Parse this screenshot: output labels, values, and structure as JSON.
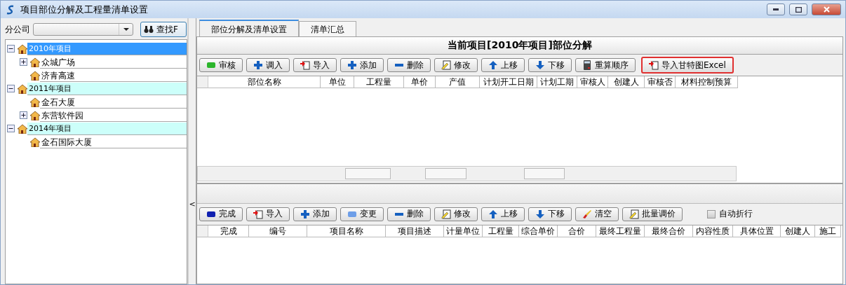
{
  "window": {
    "title": "项目部位分解及工程量清单设置"
  },
  "left_panel": {
    "branch_label": "分公司",
    "find_button": "查找F",
    "tree": [
      {
        "label": "2010年项目",
        "selected": true,
        "expanded": true,
        "children": [
          {
            "label": "众城广场",
            "selected": false,
            "expanded": false
          },
          {
            "label": "济青高速",
            "selected": false
          }
        ]
      },
      {
        "label": "2011年项目",
        "selected": false,
        "expanded": true,
        "children": [
          {
            "label": "金石大厦",
            "selected": false
          },
          {
            "label": "东营软件园",
            "selected": false,
            "expanded": false
          }
        ]
      },
      {
        "label": "2014年项目",
        "selected": false,
        "expanded": true,
        "children": [
          {
            "label": "金石国际大厦",
            "selected": false
          }
        ]
      }
    ]
  },
  "splitter": {
    "grip": "<"
  },
  "tabs": [
    {
      "label": "部位分解及清单设置",
      "selected": true
    },
    {
      "label": "清单汇总",
      "selected": false
    }
  ],
  "upper": {
    "caption": "当前项目[2010年项目]部位分解",
    "toolbar": [
      {
        "label": "审核",
        "highlighted": false
      },
      {
        "label": "调入",
        "highlighted": false
      },
      {
        "label": "导入",
        "highlighted": false
      },
      {
        "label": "添加",
        "highlighted": false
      },
      {
        "label": "删除",
        "highlighted": false
      },
      {
        "label": "修改",
        "highlighted": false
      },
      {
        "label": "上移",
        "highlighted": false
      },
      {
        "label": "下移",
        "highlighted": false
      },
      {
        "label": "重算顺序",
        "highlighted": false
      },
      {
        "label": "导入甘特图Excel",
        "highlighted": true
      }
    ],
    "columns": [
      "部位名称",
      "单位",
      "工程量",
      "单价",
      "产值",
      "计划开工日期",
      "计划工期",
      "审核人",
      "创建人",
      "审核否",
      "材料控制预算"
    ]
  },
  "lower": {
    "toolbar": [
      {
        "label": "完成"
      },
      {
        "label": "导入"
      },
      {
        "label": "添加"
      },
      {
        "label": "变更"
      },
      {
        "label": "删除"
      },
      {
        "label": "修改"
      },
      {
        "label": "上移"
      },
      {
        "label": "下移"
      },
      {
        "label": "清空"
      },
      {
        "label": "批量调价"
      }
    ],
    "auto_wrap": {
      "label": "自动折行",
      "checked": false
    },
    "columns": [
      "完成",
      "编号",
      "项目名称",
      "项目描述",
      "计量单位",
      "工程量",
      "综合单价",
      "合价",
      "最终工程量",
      "最终合价",
      "内容性质",
      "具体位置",
      "创建人",
      "施工"
    ]
  }
}
